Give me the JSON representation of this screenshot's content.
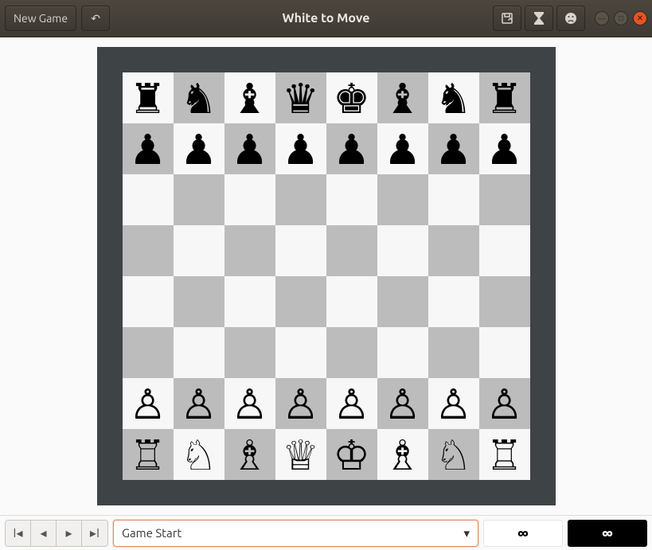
{
  "header": {
    "new_game_label": "New Game",
    "title": "White to Move"
  },
  "board": {
    "light_square_color": "#f7f7f7",
    "dark_square_color": "#bcbcbc",
    "rows": [
      [
        "r",
        "n",
        "b",
        "q",
        "k",
        "b",
        "n",
        "r"
      ],
      [
        "p",
        "p",
        "p",
        "p",
        "p",
        "p",
        "p",
        "p"
      ],
      [
        "",
        "",
        "",
        "",
        "",
        "",
        "",
        ""
      ],
      [
        "",
        "",
        "",
        "",
        "",
        "",
        "",
        ""
      ],
      [
        "",
        "",
        "",
        "",
        "",
        "",
        "",
        ""
      ],
      [
        "",
        "",
        "",
        "",
        "",
        "",
        "",
        ""
      ],
      [
        "P",
        "P",
        "P",
        "P",
        "P",
        "P",
        "P",
        "P"
      ],
      [
        "R",
        "N",
        "B",
        "Q",
        "K",
        "B",
        "N",
        "R"
      ]
    ]
  },
  "bottom": {
    "history_selected": "Game Start",
    "white_clock": "∞",
    "black_clock": "∞"
  },
  "piece_glyphs": {
    "K": "♔",
    "Q": "♕",
    "R": "♖",
    "B": "♗",
    "N": "♘",
    "P": "♙",
    "k": "♚",
    "q": "♛",
    "r": "♜",
    "b": "♝",
    "n": "♞",
    "p": "♟"
  }
}
